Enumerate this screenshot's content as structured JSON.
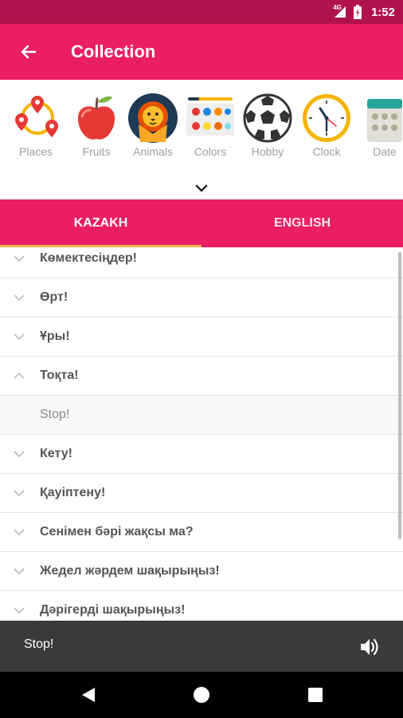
{
  "status": {
    "network": "4G",
    "time": "1:52"
  },
  "app_bar": {
    "title": "Collection"
  },
  "categories": [
    {
      "label": "Places",
      "icon": "places-icon"
    },
    {
      "label": "Fruits",
      "icon": "apple-icon"
    },
    {
      "label": "Animals",
      "icon": "lion-icon"
    },
    {
      "label": "Colors",
      "icon": "palette-icon"
    },
    {
      "label": "Hobby",
      "icon": "soccer-ball-icon"
    },
    {
      "label": "Clock",
      "icon": "clock-icon"
    },
    {
      "label": "Date",
      "icon": "calendar-icon"
    }
  ],
  "tabs": [
    {
      "label": "KAZAKH",
      "active": true
    },
    {
      "label": "ENGLISH",
      "active": false
    }
  ],
  "phrases": [
    {
      "text": "Көмектесіңдер!",
      "expanded": false
    },
    {
      "text": "Өрт!",
      "expanded": false
    },
    {
      "text": "Ұры!",
      "expanded": false
    },
    {
      "text": "Тоқта!",
      "expanded": true
    },
    {
      "text": "Stop!",
      "detail": true
    },
    {
      "text": "Кету!",
      "expanded": false
    },
    {
      "text": "Қауіптену!",
      "expanded": false
    },
    {
      "text": "Сенімен бәрі жақсы ма?",
      "expanded": false
    },
    {
      "text": "Жедел жәрдем шақырыңыз!",
      "expanded": false
    },
    {
      "text": "Дәрігерді шақырыңыз!",
      "expanded": false
    }
  ],
  "player": {
    "text": "Stop!",
    "icon": "speaker-icon"
  },
  "colors": {
    "primary": "#e91e63",
    "primary_dark": "#b0124f",
    "tab_indicator": "#ffb74d",
    "player_bg": "#3a3a3a"
  }
}
